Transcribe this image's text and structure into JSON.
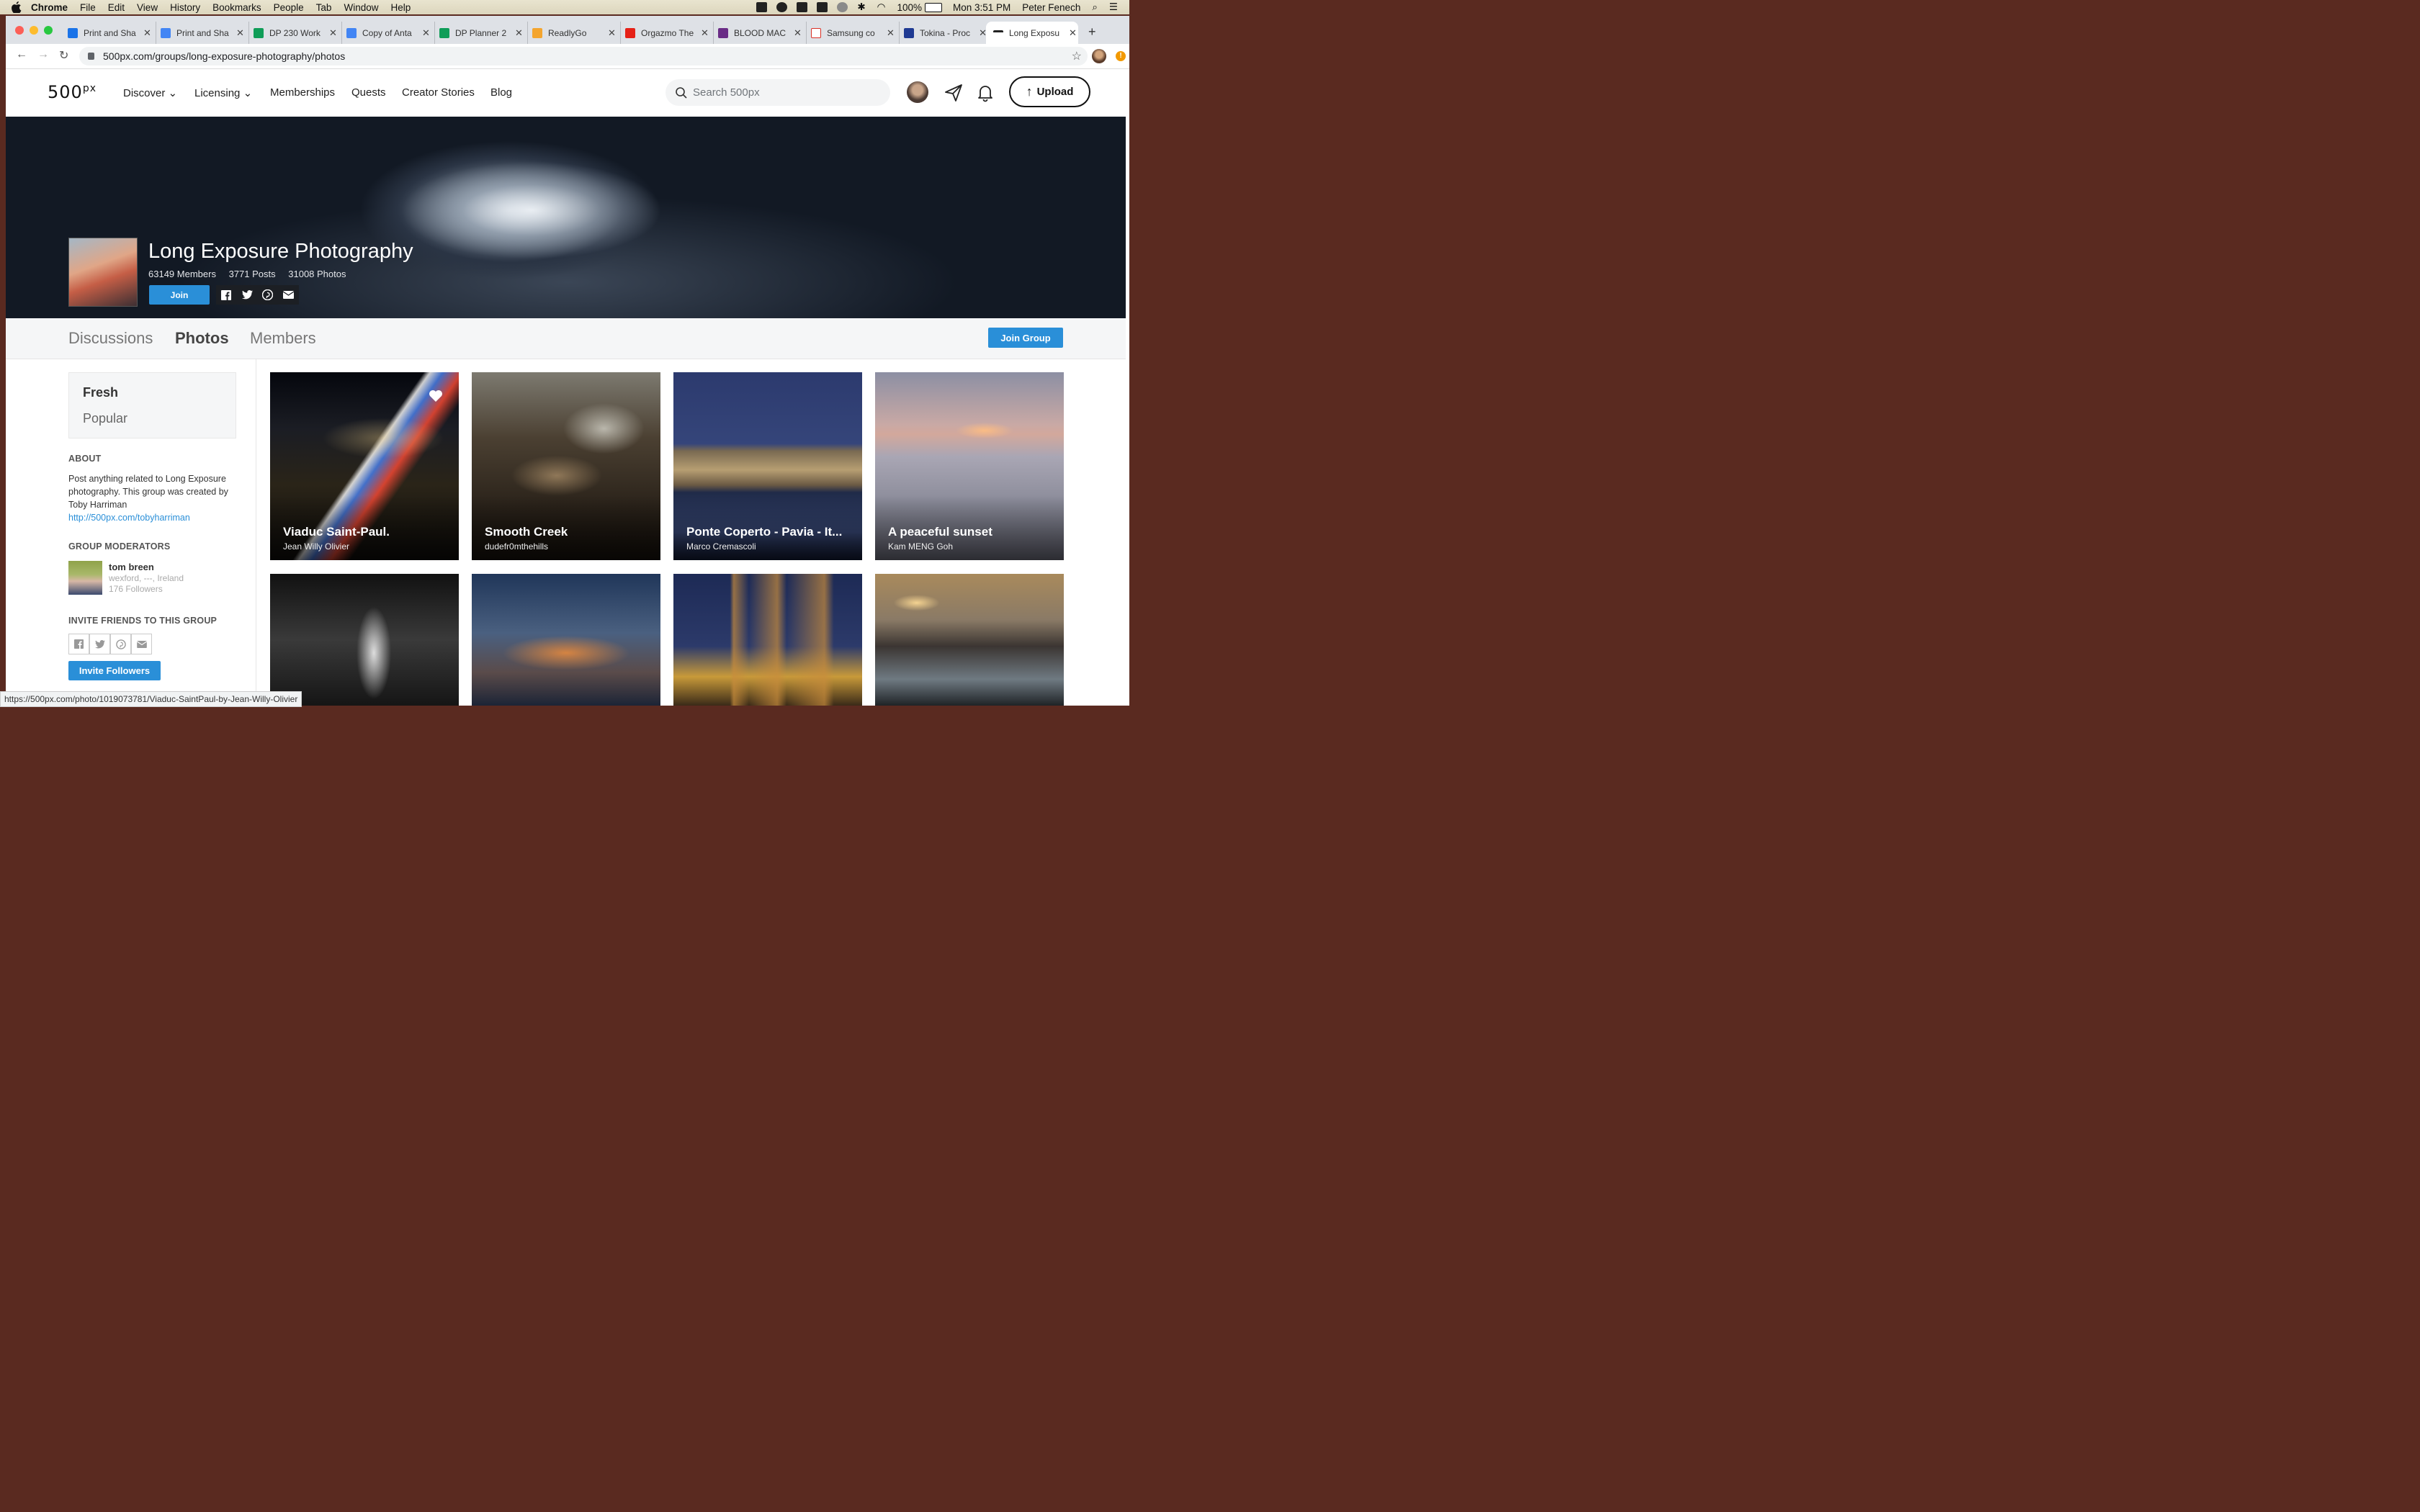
{
  "menubar": {
    "app": "Chrome",
    "menus": [
      "File",
      "Edit",
      "View",
      "History",
      "Bookmarks",
      "People",
      "Tab",
      "Window",
      "Help"
    ],
    "battery": "100%",
    "clock": "Mon 3:51 PM",
    "user": "Peter Fenech"
  },
  "tabs": [
    {
      "title": "Print and Sha",
      "color": "#1a73e8",
      "icon": "google-drive-icon"
    },
    {
      "title": "Print and Sha",
      "color": "#4285f4",
      "icon": "google-docs-icon"
    },
    {
      "title": "DP 230 Work",
      "color": "#0f9d58",
      "icon": "google-sheets-icon"
    },
    {
      "title": "Copy of Anta",
      "color": "#4285f4",
      "icon": "google-docs-icon"
    },
    {
      "title": "DP Planner 2",
      "color": "#0f9d58",
      "icon": "google-sheets-icon"
    },
    {
      "title": "ReadlyGo",
      "color": "#f4a52e",
      "icon": "readly-icon"
    },
    {
      "title": "Orgazmo The",
      "color": "#e62117",
      "icon": "youtube-icon"
    },
    {
      "title": "BLOOD MAC",
      "color": "#6a2c86",
      "icon": "site-icon"
    },
    {
      "title": "Samsung co",
      "color": "#d93025",
      "icon": "gmail-icon"
    },
    {
      "title": "Tokina - Proc",
      "color": "#1f3a93",
      "icon": "tokina-icon"
    },
    {
      "title": "Long Exposu",
      "color": "#222222",
      "icon": "500px-icon"
    }
  ],
  "url": "500px.com/groups/long-exposure-photography/photos",
  "nav": {
    "logo": "500",
    "logo_sup": "px",
    "links": [
      "Discover",
      "Licensing",
      "Memberships",
      "Quests",
      "Creator Stories",
      "Blog"
    ],
    "search_placeholder": "Search 500px",
    "upload": "Upload"
  },
  "group": {
    "title": "Long Exposure Photography",
    "members": "63149 Members",
    "posts": "3771 Posts",
    "photos": "31008 Photos",
    "join": "Join"
  },
  "subnav": {
    "tabs": [
      "Discussions",
      "Photos",
      "Members"
    ],
    "join_group": "Join Group"
  },
  "sidebar": {
    "sort_a": "Fresh",
    "sort_b": "Popular",
    "about_heading": "ABOUT",
    "about_text": "Post anything related to Long Exposure photography. This group was created by Toby Harriman",
    "about_link": "http://500px.com/tobyharriman",
    "mods_heading": "GROUP MODERATORS",
    "mod_name": "tom breen",
    "mod_location": "wexford, ---, Ireland",
    "mod_followers": "176 Followers",
    "invite_heading": "INVITE FRIENDS TO THIS GROUP",
    "invite_button": "Invite Followers"
  },
  "photos": [
    {
      "title": "Viaduc Saint-Paul.",
      "author": "Jean Willy Olivier"
    },
    {
      "title": "Smooth Creek",
      "author": "dudefr0mthehills"
    },
    {
      "title": "Ponte Coperto - Pavia - It...",
      "author": "Marco Cremascoli"
    },
    {
      "title": "A peaceful sunset",
      "author": "Kam MENG Goh"
    }
  ],
  "status_url": "https://500px.com/photo/1019073781/Viaduc-SaintPaul-by-Jean-Willy-Olivier"
}
